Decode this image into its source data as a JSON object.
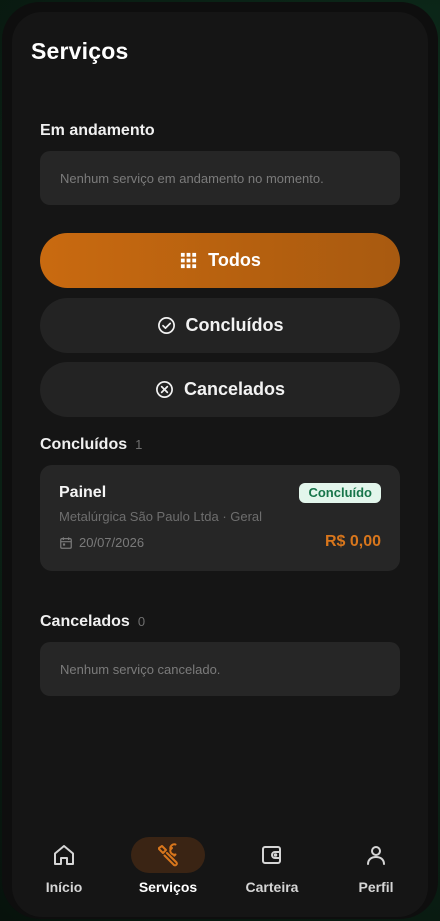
{
  "page": {
    "title": "Serviços"
  },
  "in_progress": {
    "label": "Em andamento",
    "empty_text": "Nenhum serviço em andamento no momento."
  },
  "filters": [
    {
      "label": "Todos",
      "icon": "grid-icon",
      "active": true
    },
    {
      "label": "Concluídos",
      "icon": "check-circle-icon",
      "active": false
    },
    {
      "label": "Cancelados",
      "icon": "x-circle-icon",
      "active": false
    }
  ],
  "completed": {
    "label": "Concluídos",
    "count": "1",
    "items": [
      {
        "title": "Painel",
        "subtitle": "Metalúrgica São Paulo Ltda · Geral",
        "status": "Concluído",
        "date": "20/07/2026",
        "price": "R$ 0,00"
      }
    ]
  },
  "cancelled": {
    "label": "Cancelados",
    "count": "0",
    "empty_text": "Nenhum serviço cancelado."
  },
  "nav": [
    {
      "label": "Início",
      "icon": "home-icon",
      "active": false
    },
    {
      "label": "Serviços",
      "icon": "wrench-icon",
      "active": true
    },
    {
      "label": "Carteira",
      "icon": "wallet-icon",
      "active": false
    },
    {
      "label": "Perfil",
      "icon": "user-icon",
      "active": false
    }
  ],
  "colors": {
    "accent": "#c96a10",
    "price": "#d8761c",
    "badge_bg": "#e3f6ec",
    "badge_text": "#17754a"
  }
}
